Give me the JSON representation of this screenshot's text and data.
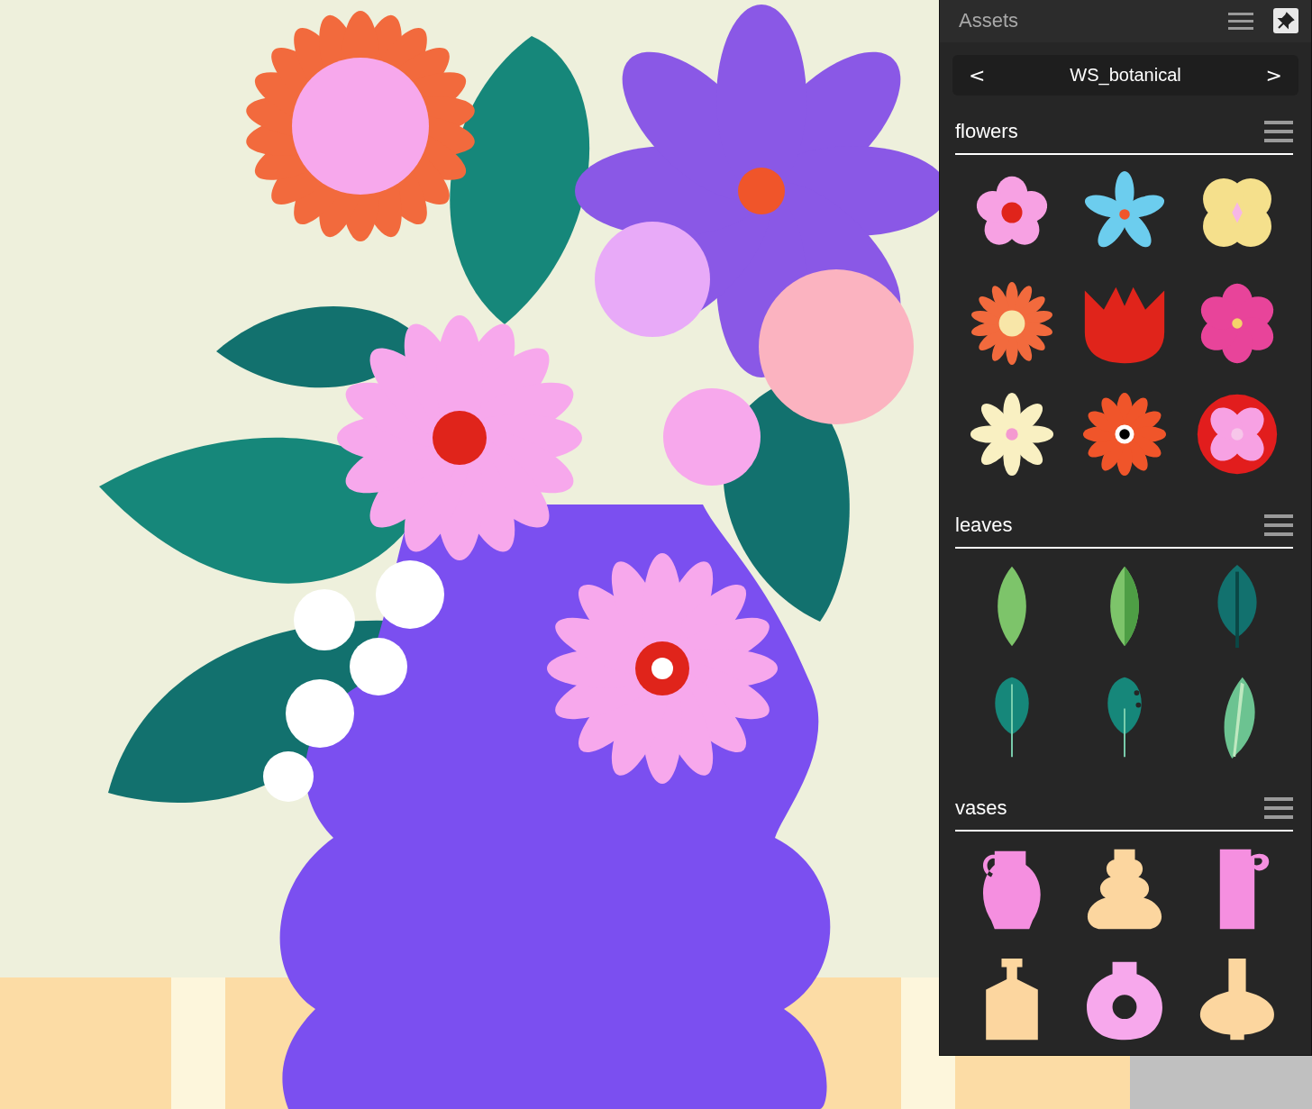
{
  "panel": {
    "title": "Assets",
    "library": {
      "prev": "<",
      "name": "WS_botanical",
      "next": ">"
    },
    "sections": [
      {
        "title": "flowers",
        "items": [
          {
            "kind": "five-petal"
          },
          {
            "kind": "star"
          },
          {
            "kind": "quatrefoil"
          },
          {
            "kind": "sunflower"
          },
          {
            "kind": "tulip"
          },
          {
            "kind": "pink-blossom"
          },
          {
            "kind": "daisy"
          },
          {
            "kind": "gerbera"
          },
          {
            "kind": "carnation"
          }
        ]
      },
      {
        "title": "leaves",
        "items": [
          {
            "kind": "plain-leaf"
          },
          {
            "kind": "split-leaf"
          },
          {
            "kind": "veined-leaf"
          },
          {
            "kind": "stem-leaf"
          },
          {
            "kind": "spotted-leaf"
          },
          {
            "kind": "fern-leaf"
          }
        ]
      },
      {
        "title": "vases",
        "items": [
          {
            "kind": "jug"
          },
          {
            "kind": "stacked-vase"
          },
          {
            "kind": "tall-jug"
          },
          {
            "kind": "bottle"
          },
          {
            "kind": "ring-vase"
          },
          {
            "kind": "round-flask"
          }
        ]
      }
    ]
  }
}
